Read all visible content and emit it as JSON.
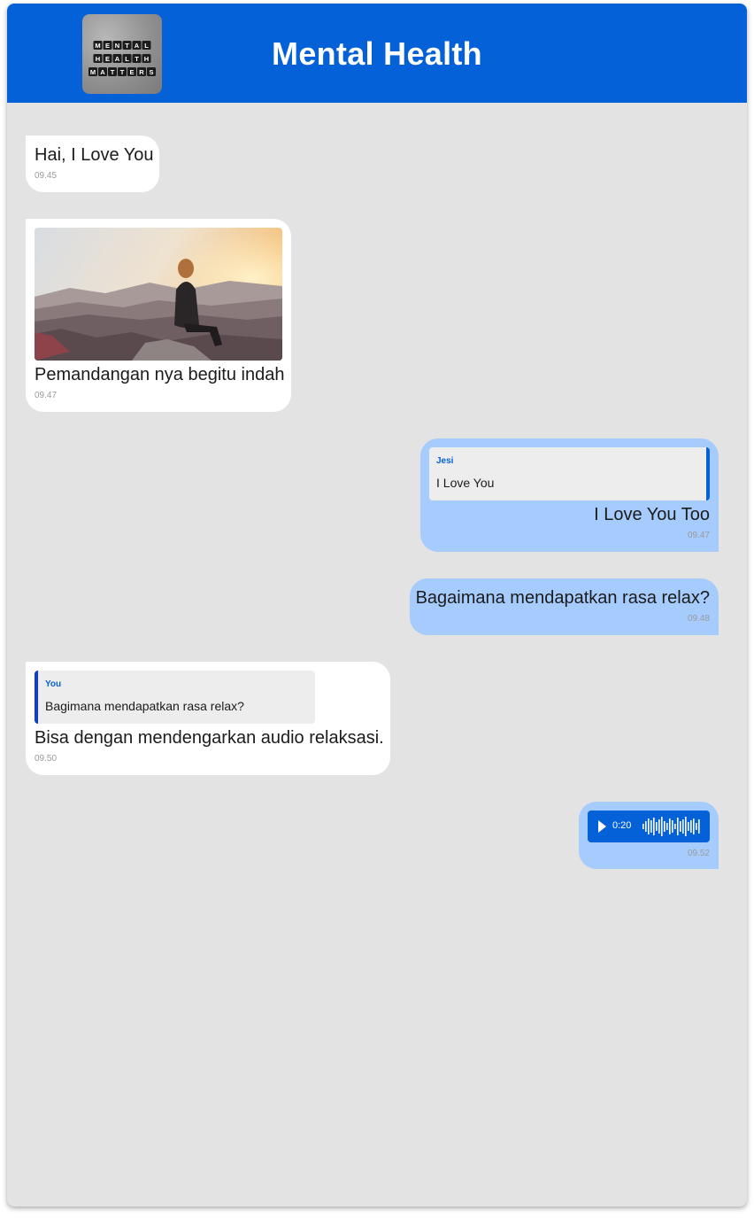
{
  "header": {
    "title": "Mental Health",
    "avatar_alt": "MENTAL HEALTH MATTERS",
    "avatar_lines": [
      "MENTAL",
      "HEALTH",
      "MATTERS"
    ]
  },
  "messages": [
    {
      "direction": "incoming",
      "text": "Hai, I Love You",
      "time": "09.45"
    },
    {
      "direction": "incoming",
      "type": "image",
      "text": "Pemandangan nya begitu indah",
      "time": "09.47"
    },
    {
      "direction": "outgoing",
      "reply_to": {
        "name": "Jesi",
        "text": "I Love You"
      },
      "text": "I Love You Too",
      "time": "09.47"
    },
    {
      "direction": "outgoing",
      "text": "Bagaimana mendapatkan rasa relax?",
      "time": "09.48"
    },
    {
      "direction": "incoming",
      "reply_to": {
        "name": "You",
        "text": "Bagimana mendapatkan rasa relax?"
      },
      "text": "Bisa dengan mendengarkan audio relaksasi.",
      "time": "09.50"
    },
    {
      "direction": "outgoing",
      "type": "audio",
      "duration": "0:20",
      "time": "09.52"
    }
  ],
  "colors": {
    "header": "#0461d8",
    "background": "#e3e3e3",
    "incoming_bubble": "#ffffff",
    "outgoing_bubble": "#a6ccfe",
    "accent": "#0461d8"
  }
}
